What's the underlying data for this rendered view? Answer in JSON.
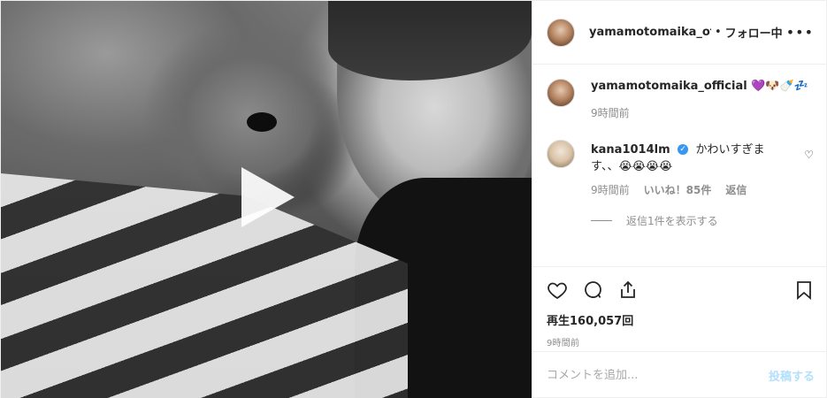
{
  "post": {
    "username": "yamamotomaika_official",
    "header_username": "yamamotomaika_offic",
    "separator": "•",
    "follow_status": "フォロー中",
    "more_label": "•••"
  },
  "caption": {
    "username": "yamamotomaika_official",
    "emojis": "💜🐶🍼💤",
    "time": "9時間前"
  },
  "comment": {
    "username": "kana1014lm",
    "verified_badge": "✓",
    "text": "かわいすぎます、、😭😭😭😭",
    "time": "9時間前",
    "likes": "いいね！85件",
    "reply_label": "返信",
    "view_replies": "返信1件を表示する"
  },
  "stats": {
    "views": "再生160,057回",
    "time": "9時間前"
  },
  "add_comment": {
    "placeholder": "コメントを追加...",
    "post_label": "投稿する"
  },
  "icons": {
    "like": "heart-icon",
    "comment": "comment-icon",
    "share": "share-icon",
    "save": "bookmark-icon",
    "play": "play-icon"
  }
}
